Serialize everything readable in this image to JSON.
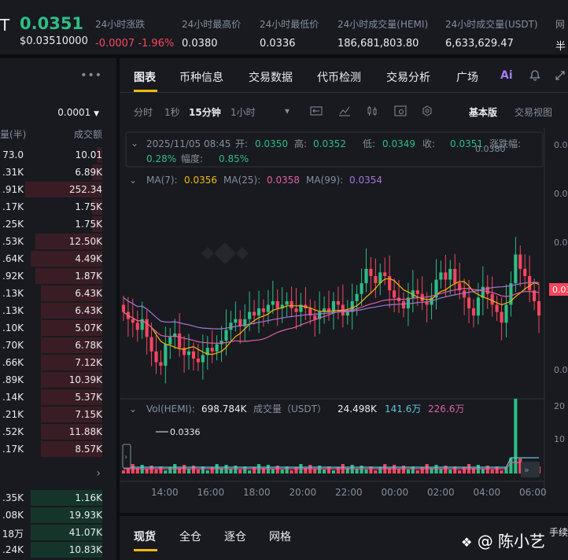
{
  "ticker": {
    "symbol_suffix": "T",
    "last_price": "0.0351",
    "usd_price": "$0.03510000",
    "stats": [
      {
        "label": "24小时涨跌",
        "value": "-0.0007",
        "value2": "-1.96%"
      },
      {
        "label": "24小时最高价",
        "value": "0.0380"
      },
      {
        "label": "24小时最低价",
        "value": "0.0336"
      },
      {
        "label": "24小时成交量(HEMI)",
        "value": "186,681,803.80"
      },
      {
        "label": "24小时成交量(USDT)",
        "value": "6,633,629.47"
      },
      {
        "label": "网",
        "value": "半"
      }
    ]
  },
  "orderbook": {
    "more_icon": "more-dots-icon",
    "precision": "0.0001",
    "header_qty": "量(半)",
    "header_total": "成交额",
    "asks": [
      {
        "qty": "73.0",
        "total": "10.01",
        "fill": 0.05
      },
      {
        "qty": ".31K",
        "total": "6.89K",
        "fill": 0.1
      },
      {
        "qty": ".91K",
        "total": "252.34",
        "fill": 0.75
      },
      {
        "qty": ".17K",
        "total": "1.75K",
        "fill": 0.1
      },
      {
        "qty": ".25K",
        "total": "1.75K",
        "fill": 0.1
      },
      {
        "qty": ".53K",
        "total": "12.50K",
        "fill": 0.65
      },
      {
        "qty": ".64K",
        "total": "4.49K",
        "fill": 0.7
      },
      {
        "qty": ".92K",
        "total": "1.87K",
        "fill": 0.65
      },
      {
        "qty": ".13K",
        "total": "6.43K",
        "fill": 0.6
      },
      {
        "qty": ".13K",
        "total": "6.43K",
        "fill": 0.6
      },
      {
        "qty": ".10K",
        "total": "5.07K",
        "fill": 0.6
      },
      {
        "qty": ".70K",
        "total": "6.78K",
        "fill": 0.6
      },
      {
        "qty": ".66K",
        "total": "7.12K",
        "fill": 0.6
      },
      {
        "qty": ".89K",
        "total": "10.39K",
        "fill": 0.6
      },
      {
        "qty": ".14K",
        "total": "5.37K",
        "fill": 0.6
      },
      {
        "qty": ".21K",
        "total": "7.15K",
        "fill": 0.6
      },
      {
        "qty": ".52K",
        "total": "11.88K",
        "fill": 0.6
      },
      {
        "qty": ".17K",
        "total": "8.57K",
        "fill": 0.6
      }
    ],
    "bids": [
      {
        "qty": ".35K",
        "total": "1.16K",
        "fill": 0.7
      },
      {
        "qty": ".08K",
        "total": "19.93K",
        "fill": 0.7
      },
      {
        "qty": "18万",
        "total": "41.07K",
        "fill": 0.7
      },
      {
        "qty": ".24K",
        "total": "10.83K",
        "fill": 0.7
      }
    ]
  },
  "tabs": [
    "图表",
    "币种信息",
    "交易数据",
    "代币检测",
    "交易分析",
    "广场"
  ],
  "tab_icons": [
    "ai-icon",
    "bell-icon",
    "expand-icon"
  ],
  "toolbar": {
    "intervals": [
      "分时",
      "1秒",
      "15分钟",
      "1小时"
    ],
    "active_interval": "15分钟",
    "views": [
      "基本版",
      "交易视图"
    ],
    "active_view": "基本版"
  },
  "chart_data": {
    "type": "candlestick",
    "ohlc_info": {
      "time": "2025/11/05 08:45",
      "open_label": "开:",
      "open": "0.0350",
      "high_label": "高:",
      "high": "0.0352",
      "low_label": "低:",
      "low": "0.0349",
      "close_label": "收:",
      "close": "0.0351",
      "chg_label": "涨跌幅:",
      "chg": "0.28%",
      "amp_label": "幅度:",
      "amp": "0.85%"
    },
    "ma": [
      {
        "name": "MA(7):",
        "value": "0.0356",
        "color": "#f0b90b"
      },
      {
        "name": "MA(25):",
        "value": "0.0358",
        "color": "#e05fa3"
      },
      {
        "name": "MA(99):",
        "value": "0.0354",
        "color": "#a276d6"
      }
    ],
    "high_marker": "0.0380",
    "low_marker": "0.0336",
    "current_price_tag": "0.03",
    "y_ticks": [
      "0.0",
      "0.0",
      "0.0",
      "0.0",
      "0.0"
    ],
    "x_ticks": [
      "14:00",
      "16:00",
      "18:00",
      "20:00",
      "22:00",
      "00:00",
      "02:00",
      "04:00",
      "06:00"
    ],
    "ylim": [
      0.033,
      0.0385
    ],
    "closes": [
      0.0352,
      0.035,
      0.0349,
      0.0347,
      0.035,
      0.0345,
      0.0341,
      0.0338,
      0.0337,
      0.0343,
      0.0345,
      0.0346,
      0.0342,
      0.034,
      0.0341,
      0.0339,
      0.0338,
      0.034,
      0.0342,
      0.0341,
      0.0343,
      0.0344,
      0.0347,
      0.0349,
      0.035,
      0.0348,
      0.035,
      0.0352,
      0.0351,
      0.0353,
      0.0352,
      0.0354,
      0.0355,
      0.0353,
      0.0354,
      0.0355,
      0.0353,
      0.0352,
      0.0354,
      0.0353,
      0.0351,
      0.035,
      0.0352,
      0.0353,
      0.0352,
      0.0355,
      0.0354,
      0.0351,
      0.0352,
      0.0355,
      0.0357,
      0.036,
      0.0364,
      0.0362,
      0.036,
      0.0363,
      0.0362,
      0.0358,
      0.0356,
      0.0355,
      0.0353,
      0.0356,
      0.0358,
      0.0357,
      0.0355,
      0.0354,
      0.0356,
      0.0361,
      0.0363,
      0.0361,
      0.0364,
      0.036,
      0.0358,
      0.0356,
      0.0353,
      0.0351,
      0.0356,
      0.0359,
      0.0357,
      0.0354,
      0.0352,
      0.0349,
      0.0354,
      0.036,
      0.0368,
      0.0364,
      0.0362,
      0.0358,
      0.0355,
      0.0351
    ],
    "volume_series": [
      {
        "name": "Vol(HEMI):",
        "value": "698.784K",
        "color": "#848e9c"
      },
      {
        "name": "成交量（USDT）",
        "value": "24.498K",
        "color": "#848e9c"
      },
      {
        "name": "",
        "value": "141.6万",
        "color": "#5ec7d6"
      },
      {
        "name": "",
        "value": "226.6万",
        "color": "#e05fa3"
      }
    ],
    "vol_y_ticks": [
      "20",
      "10"
    ]
  },
  "bottom_tabs": [
    "现货",
    "全仓",
    "逐仓",
    "网格"
  ],
  "bottom_right": "手续",
  "watermark": "@ 陈小艺"
}
